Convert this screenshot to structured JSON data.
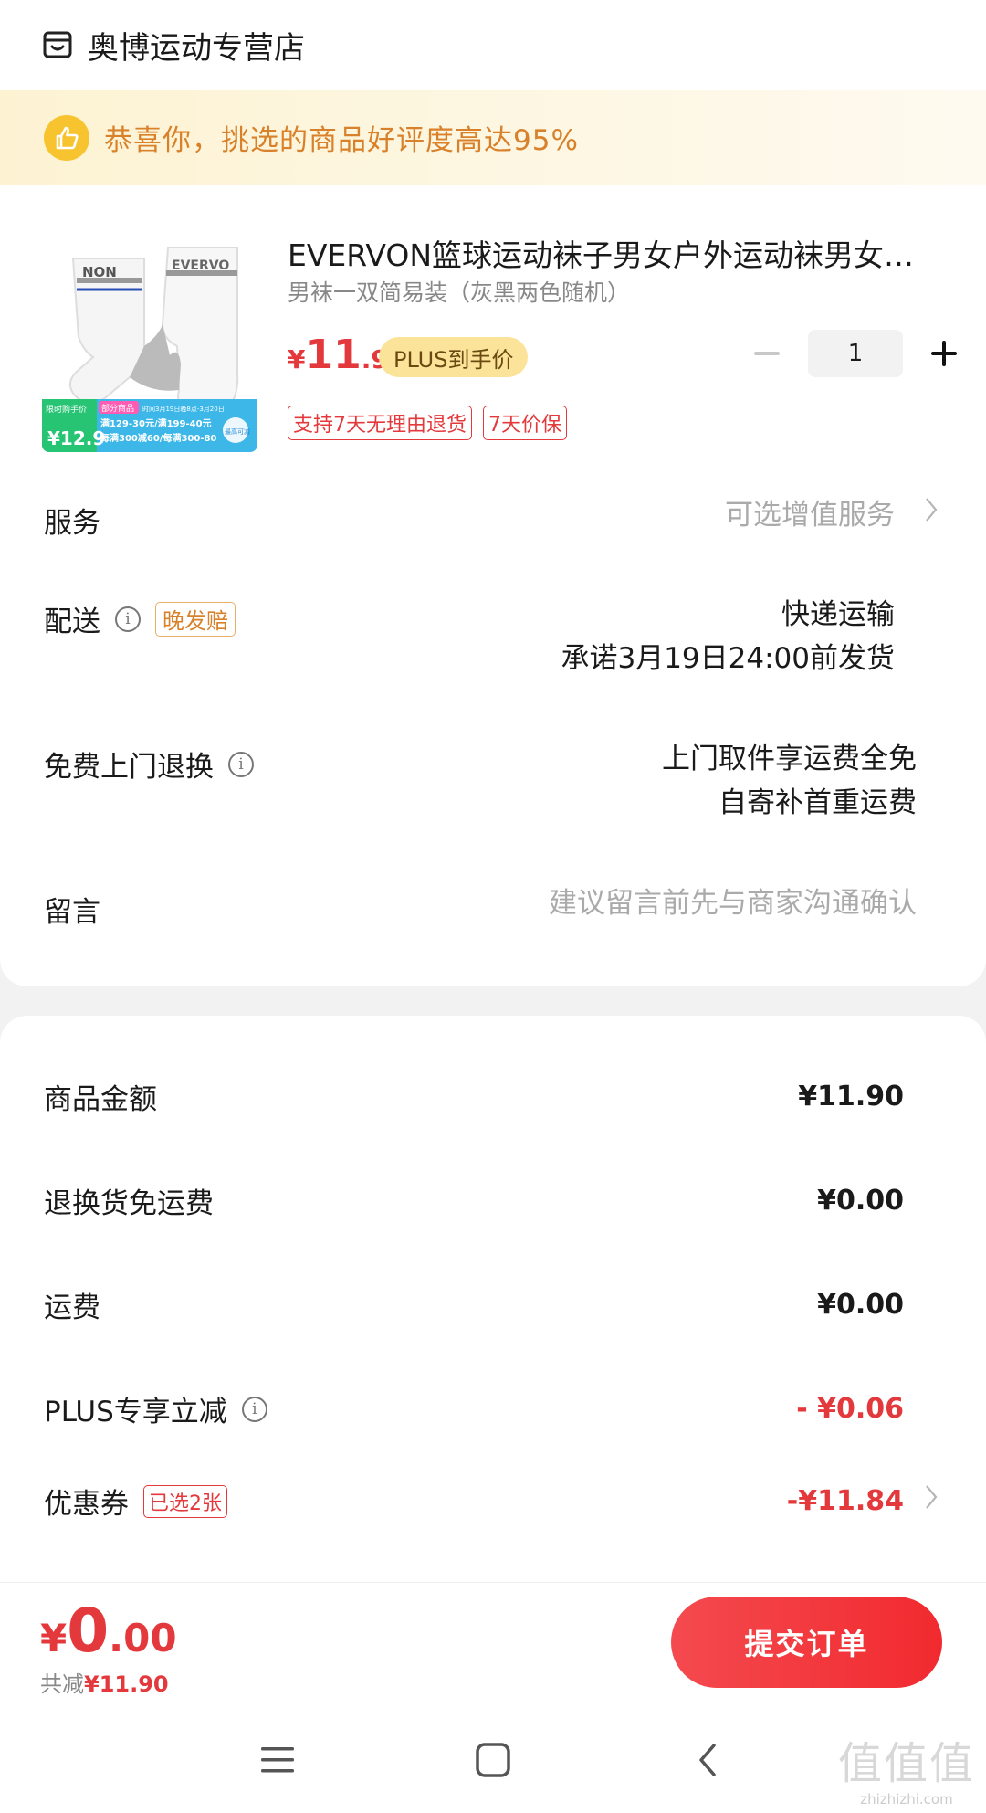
{
  "store": {
    "name": "奥博运动专营店",
    "icon": "store-icon"
  },
  "banner": {
    "text": "恭喜你，挑选的商品好评度高达95%",
    "icon": "thumbs-up-icon"
  },
  "product": {
    "title": "EVERVON篮球运动袜子男女户外运动袜男女…",
    "spec": "男袜一双简易装（灰黑两色随机）",
    "price_yen": "¥",
    "price_int": "11",
    "price_dec": ".9",
    "plus_tag": "PLUS到手价",
    "quantity": "1",
    "tags": [
      "支持7天无理由退货",
      "7天价保"
    ],
    "image_text": {
      "brand_left": "NON",
      "brand_right": "EVERVO",
      "badge_small": "限时购手价",
      "badge_price": "¥12.9",
      "promo_tag": "部分商品",
      "promo_date": "时间3月19日晚8点-3月20日",
      "promo_line1": "满129-30元/满199-40元",
      "promo_line2": "每满300减60/每满300-80",
      "promo_end": "最高可减"
    }
  },
  "rows": {
    "service_label": "服务",
    "service_value": "可选增值服务",
    "delivery_label": "配送",
    "delivery_tag": "晚发赔",
    "delivery_line1": "快递运输",
    "delivery_line2": "承诺3月19日24:00前发货",
    "return_label": "免费上门退换",
    "return_line1": "上门取件享运费全免",
    "return_line2": "自寄补首重运费",
    "message_label": "留言",
    "message_placeholder": "建议留言前先与商家沟通确认"
  },
  "summary": {
    "goods_label": "商品金额",
    "goods_value": "¥11.90",
    "return_fee_label": "退换货免运费",
    "return_fee_value": "¥0.00",
    "shipping_label": "运费",
    "shipping_value": "¥0.00",
    "plus_label": "PLUS专享立减",
    "plus_value": "- ¥0.06",
    "coupon_label": "优惠券",
    "coupon_tag": "已选2张",
    "coupon_value": "-¥11.84"
  },
  "footer": {
    "total_yen": "¥",
    "total_int": "0",
    "total_dec": ".00",
    "saved_label": "共减",
    "saved_value": "¥11.90",
    "submit_label": "提交订单"
  },
  "watermark": {
    "big": "值值值",
    "small": "zhizhizhi.com"
  },
  "colors": {
    "accent_red": "#e4393c",
    "plus_gold": "#fbe49a",
    "banner_text": "#d9812a"
  }
}
